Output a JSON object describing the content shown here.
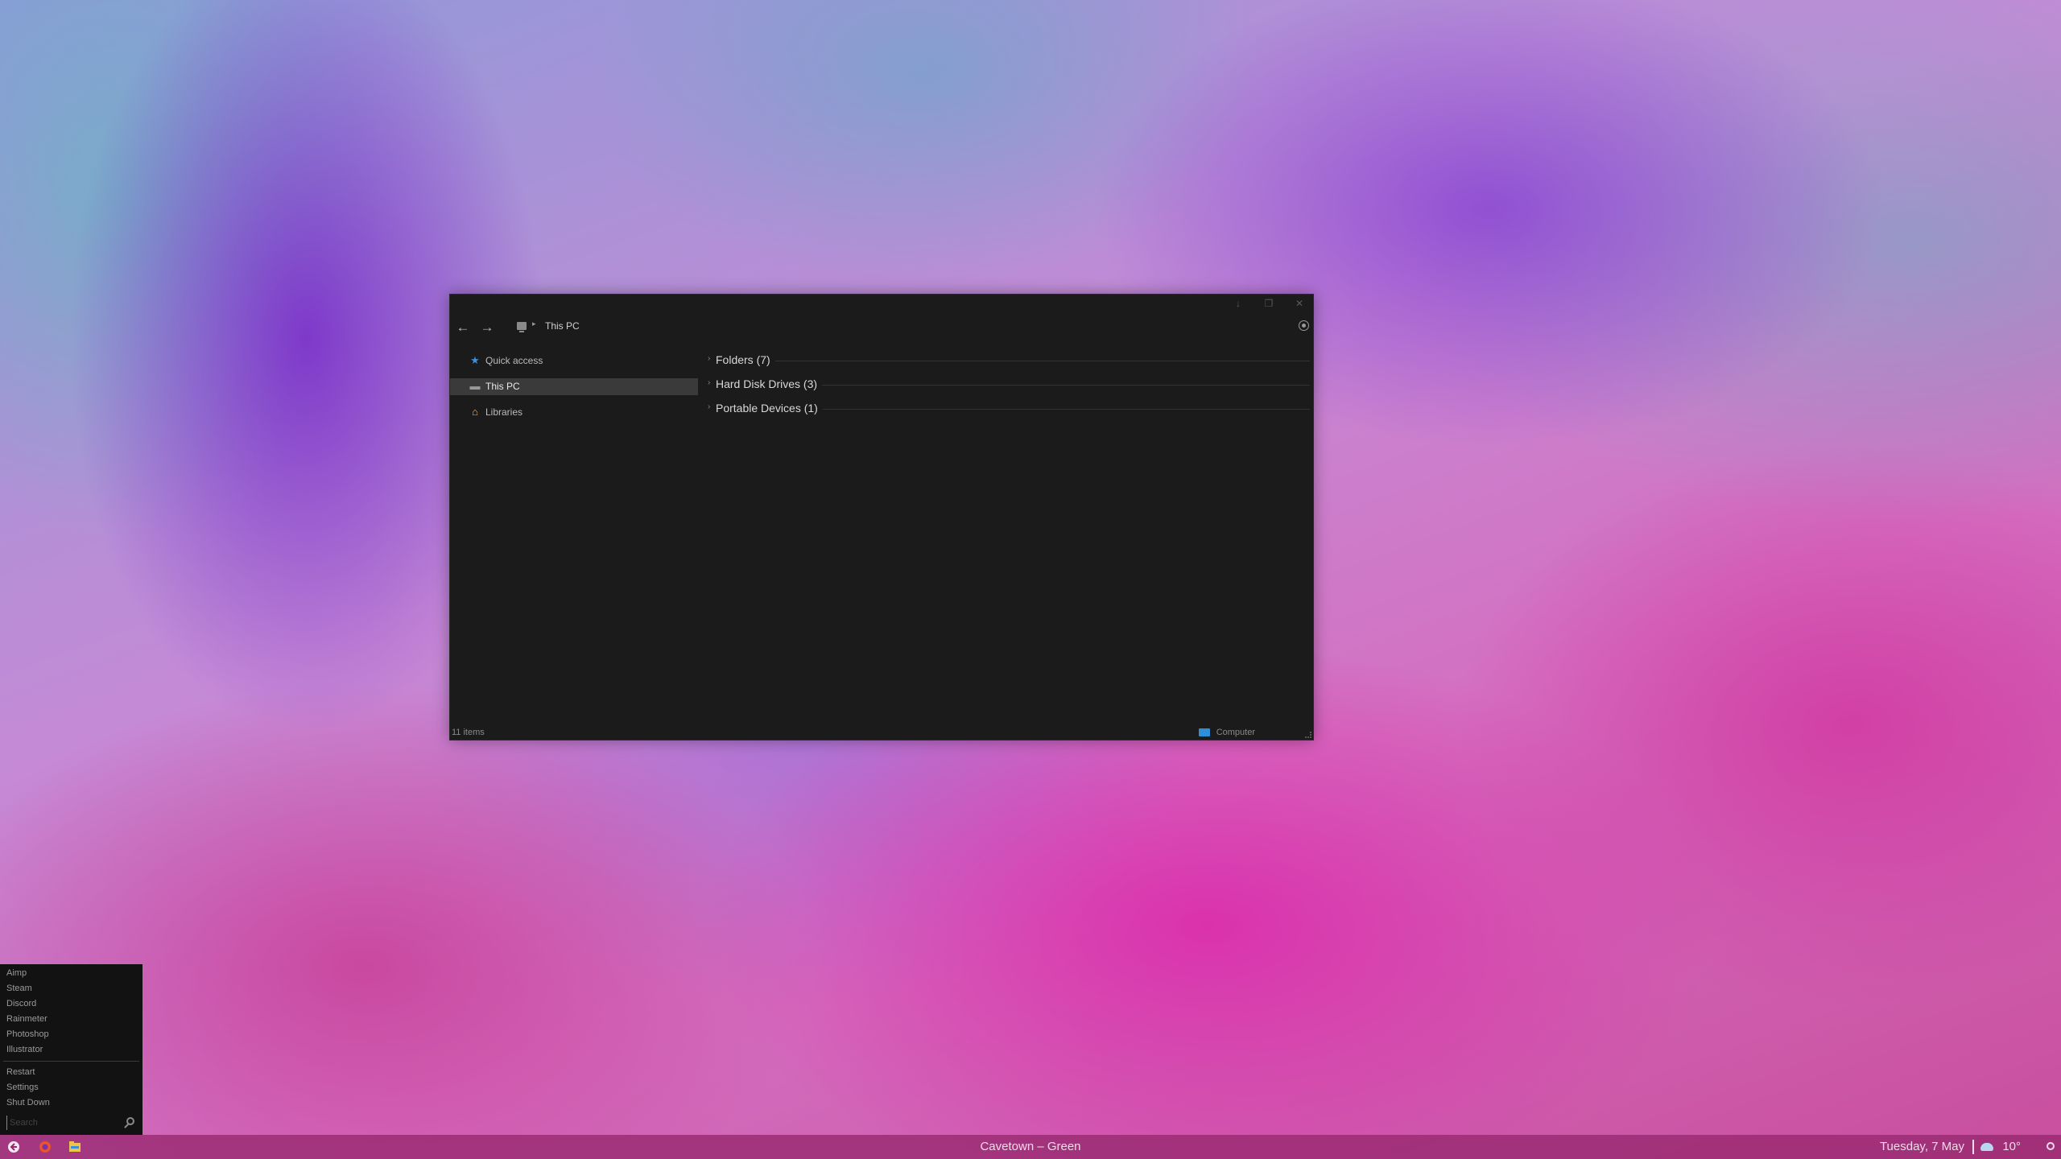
{
  "explorer": {
    "title_controls": {
      "minimize_glyph": "↓",
      "maximize_glyph": "❐",
      "close_glyph": "✕"
    },
    "toolbar": {
      "back_glyph": "←",
      "forward_glyph": "→",
      "breadcrumb_separator": "▸",
      "breadcrumb_location": "This PC"
    },
    "sidebar": {
      "items": [
        {
          "label": "Quick access",
          "icon": "star-icon",
          "glyph": "★",
          "icon_color": "#3d8fe0",
          "selected": false
        },
        {
          "label": "This PC",
          "icon": "computer-icon",
          "glyph": "▬",
          "icon_color": "#9a9a9a",
          "selected": true
        },
        {
          "label": "Libraries",
          "icon": "home-icon",
          "glyph": "⌂",
          "icon_color": "#e8b04a",
          "selected": false
        }
      ]
    },
    "groups": [
      {
        "chevron": "›",
        "title": "Folders (7)"
      },
      {
        "chevron": "›",
        "title": "Hard Disk Drives (3)"
      },
      {
        "chevron": "›",
        "title": "Portable Devices (1)"
      }
    ],
    "status": {
      "item_count": "11 items",
      "location_label": "Computer"
    }
  },
  "start_menu": {
    "apps": [
      "Aimp",
      "Steam",
      "Discord",
      "Rainmeter",
      "Photoshop",
      "Illustrator"
    ],
    "power": [
      "Restart",
      "Settings",
      "Shut Down"
    ],
    "search_placeholder": "Search"
  },
  "taskbar": {
    "now_playing": "Cavetown – Green",
    "date": "Tuesday, 7 May",
    "temperature": "10°"
  },
  "colors": {
    "explorer_bg": "#1b1b1b",
    "selection": "#3a3a3a",
    "taskbar": "#96286e",
    "accent_blue": "#2f8fd6"
  }
}
